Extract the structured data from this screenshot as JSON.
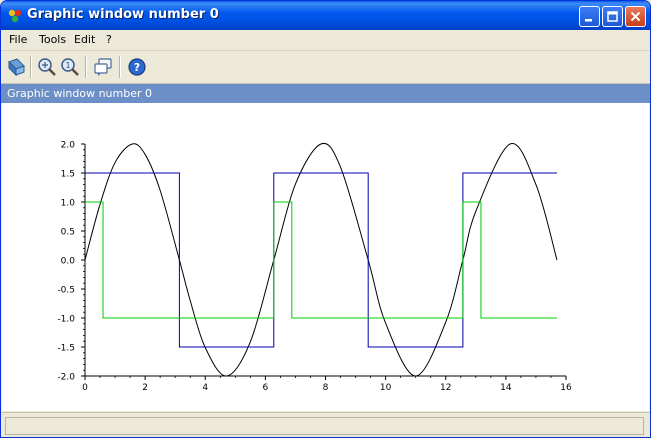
{
  "window": {
    "title": "Graphic window number 0"
  },
  "menu": {
    "items": [
      "File",
      "Tools",
      "Edit",
      "?"
    ]
  },
  "toolbar": {
    "tools": [
      "rotate-icon",
      "zoom-icon",
      "zoom-fit-icon",
      "datatip-icon",
      "help-icon"
    ]
  },
  "figure": {
    "label": "Graphic window number 0"
  },
  "chart_data": {
    "type": "line",
    "title": "",
    "xlabel": "",
    "ylabel": "",
    "xlim": [
      0,
      16
    ],
    "ylim": [
      -2.0,
      2.0
    ],
    "xticks": [
      0,
      2,
      4,
      6,
      8,
      10,
      12,
      14,
      16
    ],
    "xtick_labels": [
      "0",
      "2",
      "4",
      "6",
      "8",
      "10",
      "12",
      "14",
      "16"
    ],
    "yticks": [
      -2.0,
      -1.5,
      -1.0,
      -0.5,
      0.0,
      0.5,
      1.0,
      1.5,
      2.0
    ],
    "ytick_labels": [
      "-2.0",
      "-1.5",
      "-1.0",
      "-0.5",
      "0.0",
      "0.5",
      "1.0",
      "1.5",
      "2.0"
    ],
    "grid": false,
    "series": [
      {
        "color": "#000000",
        "x": [
          0,
          0.5,
          1.0,
          1.57,
          2.0,
          2.5,
          3.14,
          3.5,
          4.0,
          4.71,
          5.5,
          6.28,
          7.0,
          7.85,
          8.5,
          9.42,
          10.0,
          11.0,
          12.0,
          12.57,
          13.0,
          14.14,
          15.0,
          15.7
        ],
        "y": [
          0,
          0.96,
          1.68,
          2.0,
          1.82,
          1.2,
          0,
          -0.7,
          -1.51,
          -2.0,
          -1.41,
          0,
          1.31,
          2.0,
          1.6,
          0,
          -1.09,
          -2.0,
          -1.07,
          0,
          0.84,
          2.0,
          1.3,
          0
        ]
      },
      {
        "color": "#0000aa",
        "x": [
          0,
          3.14,
          3.14,
          6.28,
          6.28,
          9.42,
          9.42,
          12.57,
          12.57,
          15.7
        ],
        "y": [
          1.5,
          1.5,
          -1.5,
          -1.5,
          1.5,
          1.5,
          -1.5,
          -1.5,
          1.5,
          1.5
        ]
      },
      {
        "color": "#00cc00",
        "x": [
          0,
          0.6,
          0.6,
          6.28,
          6.28,
          6.88,
          6.88,
          12.57,
          12.57,
          13.17,
          13.17,
          15.7
        ],
        "y": [
          1.0,
          1.0,
          -1.0,
          -1.0,
          1.0,
          1.0,
          -1.0,
          -1.0,
          1.0,
          1.0,
          -1.0,
          -1.0
        ]
      }
    ]
  }
}
